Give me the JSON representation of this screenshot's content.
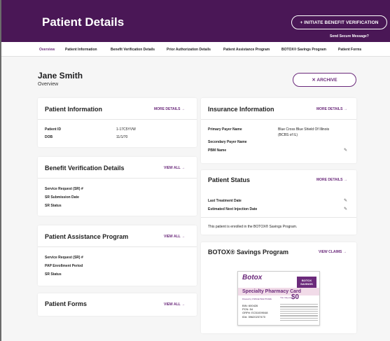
{
  "header": {
    "title": "Patient Details",
    "initiate_button": "+ INITIATE BENEFIT VERIFICATION",
    "send_secure_message": "Send Secure Message?"
  },
  "nav": {
    "tabs": [
      {
        "label": "Overview",
        "active": true
      },
      {
        "label": "Patient Information"
      },
      {
        "label": "Benefit Verification Details"
      },
      {
        "label": "Prior Authorization Details"
      },
      {
        "label": "Patient Assistance Program"
      },
      {
        "label": "BOTOX® Savings Program"
      },
      {
        "label": "Patient Forms"
      }
    ]
  },
  "patient": {
    "name": "Jane Smith",
    "subtitle": "Overview",
    "archive_button": "✕ ARCHIVE"
  },
  "cards": {
    "patient_info": {
      "title": "Patient Information",
      "link": "MORE DETAILS →",
      "rows": [
        {
          "label": "Patient ID",
          "value": "1-17C5YVW"
        },
        {
          "label": "DOB",
          "value": "11/1/70"
        }
      ]
    },
    "benefit_verification": {
      "title": "Benefit Verification Details",
      "link": "VIEW ALL →",
      "rows": [
        "Service Request (SR) #",
        "SR Submission Date",
        "SR Status"
      ]
    },
    "patient_assistance": {
      "title": "Patient Assistance Program",
      "link": "VIEW ALL →",
      "rows": [
        "Service Request (SR) #",
        "PAP Enrollment Period",
        "SR Status"
      ]
    },
    "patient_forms": {
      "title": "Patient Forms",
      "link": "VIEW ALL →"
    },
    "insurance": {
      "title": "Insurance Information",
      "link": "MORE DETAILS →",
      "primary_label": "Primary Payer Name",
      "primary_value_line1": "Blue Cross Blue Shield Of Illinois",
      "primary_value_line2": "(BCBS of IL)",
      "secondary_label": "Secondary Payer Name",
      "pbm_label": "PBM Name"
    },
    "patient_status": {
      "title": "Patient Status",
      "link": "MORE DETAILS →",
      "last_treatment_label": "Last Treatment Date",
      "next_injection_label": "Estimated Next Injection Date",
      "note": "This patient is enrolled in the BOTOX® Savings Program."
    },
    "savings": {
      "title": "BOTOX® Savings Program",
      "link": "VIEW CLAIMS →",
      "card": {
        "logo": "Botox",
        "badge_line1": "BOTOX",
        "badge_line2": "SAVINGS",
        "band": "Specialty Pharmacy Card",
        "powered": "Powered by CHANGE HEALTHCARE",
        "pay": "You may pay",
        "amount": "$0",
        "bin": "BIN: 600426",
        "pcn": "PCN: 54",
        "grp": "GRP#: EC51009048",
        "id": "ID#: 39620237470"
      }
    }
  },
  "colors": {
    "header_bg": "#4a1756",
    "accent": "#6b2a7b",
    "page_bg": "#f6f6f6"
  }
}
